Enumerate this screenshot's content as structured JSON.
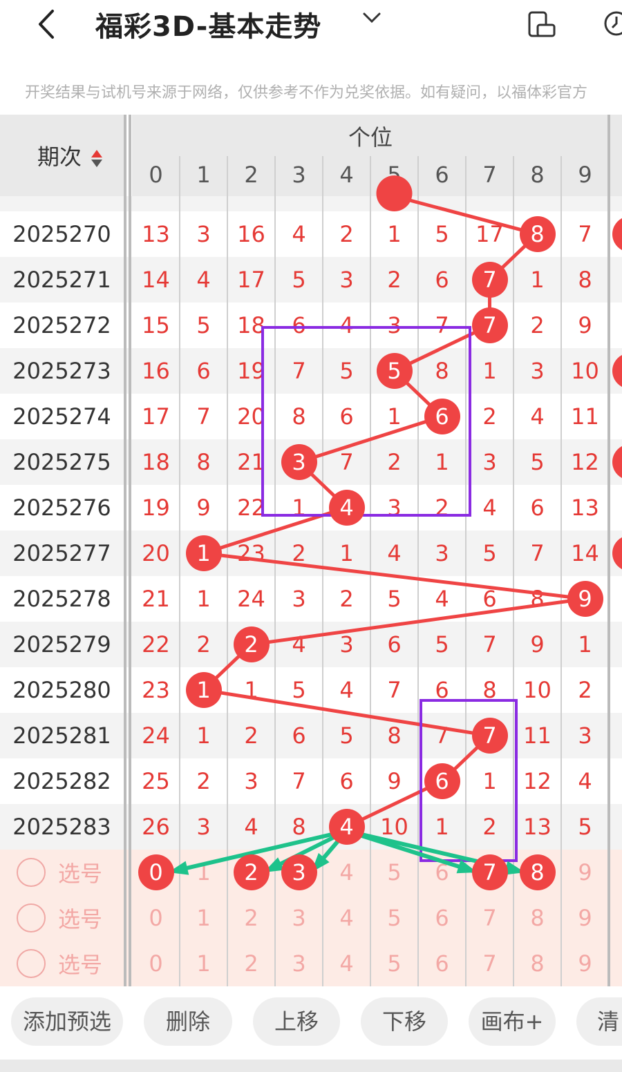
{
  "header": {
    "back_icon": "chevron-left-icon",
    "title": "福彩3D-基本走势",
    "dropdown_icon": "chevron-down-icon",
    "phone_icon": "phone-rotate-icon",
    "clock_icon": "clock-icon"
  },
  "notice": "开奖结果与试机号来源于网络，仅供参考不作为兑奖依据。如有疑问，以福体彩官方",
  "grid": {
    "period_label": "期次",
    "section_label": "个位",
    "digits": [
      "0",
      "1",
      "2",
      "3",
      "4",
      "5",
      "6",
      "7",
      "8",
      "9"
    ],
    "rows": [
      {
        "period": "2025270",
        "cells": [
          "13",
          "3",
          "16",
          "4",
          "2",
          "1",
          "5",
          "17",
          "8",
          "7"
        ],
        "hit": 8
      },
      {
        "period": "2025271",
        "cells": [
          "14",
          "4",
          "17",
          "5",
          "3",
          "2",
          "6",
          "7",
          "1",
          "8"
        ],
        "hit": 7
      },
      {
        "period": "2025272",
        "cells": [
          "15",
          "5",
          "18",
          "6",
          "4",
          "3",
          "7",
          "7",
          "2",
          "9"
        ],
        "hit": 7
      },
      {
        "period": "2025273",
        "cells": [
          "16",
          "6",
          "19",
          "7",
          "5",
          "5",
          "8",
          "1",
          "3",
          "10"
        ],
        "hit": 5
      },
      {
        "period": "2025274",
        "cells": [
          "17",
          "7",
          "20",
          "8",
          "6",
          "1",
          "6",
          "2",
          "4",
          "11"
        ],
        "hit": 6
      },
      {
        "period": "2025275",
        "cells": [
          "18",
          "8",
          "21",
          "3",
          "7",
          "2",
          "1",
          "3",
          "5",
          "12"
        ],
        "hit": 3
      },
      {
        "period": "2025276",
        "cells": [
          "19",
          "9",
          "22",
          "1",
          "4",
          "3",
          "2",
          "4",
          "6",
          "13"
        ],
        "hit": 4
      },
      {
        "period": "2025277",
        "cells": [
          "20",
          "1",
          "23",
          "2",
          "1",
          "4",
          "3",
          "5",
          "7",
          "14"
        ],
        "hit": 1
      },
      {
        "period": "2025278",
        "cells": [
          "21",
          "1",
          "24",
          "3",
          "2",
          "5",
          "4",
          "6",
          "8",
          "9"
        ],
        "hit": 9
      },
      {
        "period": "2025279",
        "cells": [
          "22",
          "2",
          "2",
          "4",
          "3",
          "6",
          "5",
          "7",
          "9",
          "1"
        ],
        "hit": 2
      },
      {
        "period": "2025280",
        "cells": [
          "23",
          "1",
          "1",
          "5",
          "4",
          "7",
          "6",
          "8",
          "10",
          "2"
        ],
        "hit": 1
      },
      {
        "period": "2025281",
        "cells": [
          "24",
          "1",
          "2",
          "6",
          "5",
          "8",
          "7",
          "7",
          "11",
          "3"
        ],
        "hit": 7
      },
      {
        "period": "2025282",
        "cells": [
          "25",
          "2",
          "3",
          "7",
          "6",
          "9",
          "6",
          "1",
          "12",
          "4"
        ],
        "hit": 6
      },
      {
        "period": "2025283",
        "cells": [
          "26",
          "3",
          "4",
          "8",
          "4",
          "10",
          "1",
          "2",
          "13",
          "5"
        ],
        "hit": 4
      }
    ],
    "select_rows": [
      {
        "label": "选号",
        "selected": [
          0,
          2,
          3,
          7,
          8
        ]
      },
      {
        "label": "选号",
        "selected": []
      },
      {
        "label": "选号",
        "selected": []
      }
    ]
  },
  "toolbar": {
    "buttons": [
      "添加预选",
      "删除",
      "上移",
      "下移",
      "画布+",
      "清"
    ]
  },
  "colors": {
    "ball": "#ef4444",
    "line": "#ef4444",
    "box": "#8a2be2",
    "arrow": "#1ec28b",
    "pink_row": "#fdebe5"
  }
}
